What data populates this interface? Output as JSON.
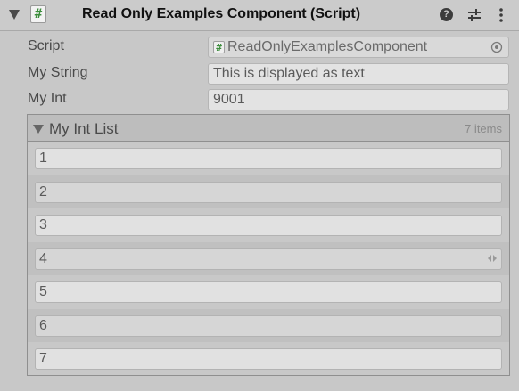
{
  "header": {
    "title": "Read Only Examples Component (Script)",
    "script_icon_glyph": "#",
    "icons": [
      "foldout-arrow-icon",
      "script-icon",
      "help-icon",
      "settings-icon",
      "menu-icon"
    ],
    "help_glyph": "?"
  },
  "properties": [
    {
      "label": "Script",
      "value": "ReadOnlyExamplesComponent",
      "icon": "script-object-icon"
    },
    {
      "label": "My String",
      "value": "This is displayed as text"
    },
    {
      "label": "My Int",
      "value": "9001"
    }
  ],
  "list": {
    "title": "My Int List",
    "count_label": "7 items",
    "items": [
      "1",
      "2",
      "3",
      "4",
      "5",
      "6",
      "7"
    ]
  },
  "colors": {
    "background": "#c8c8c8",
    "script_hash": "#3c8d3c",
    "field": "#e3e3e3"
  }
}
